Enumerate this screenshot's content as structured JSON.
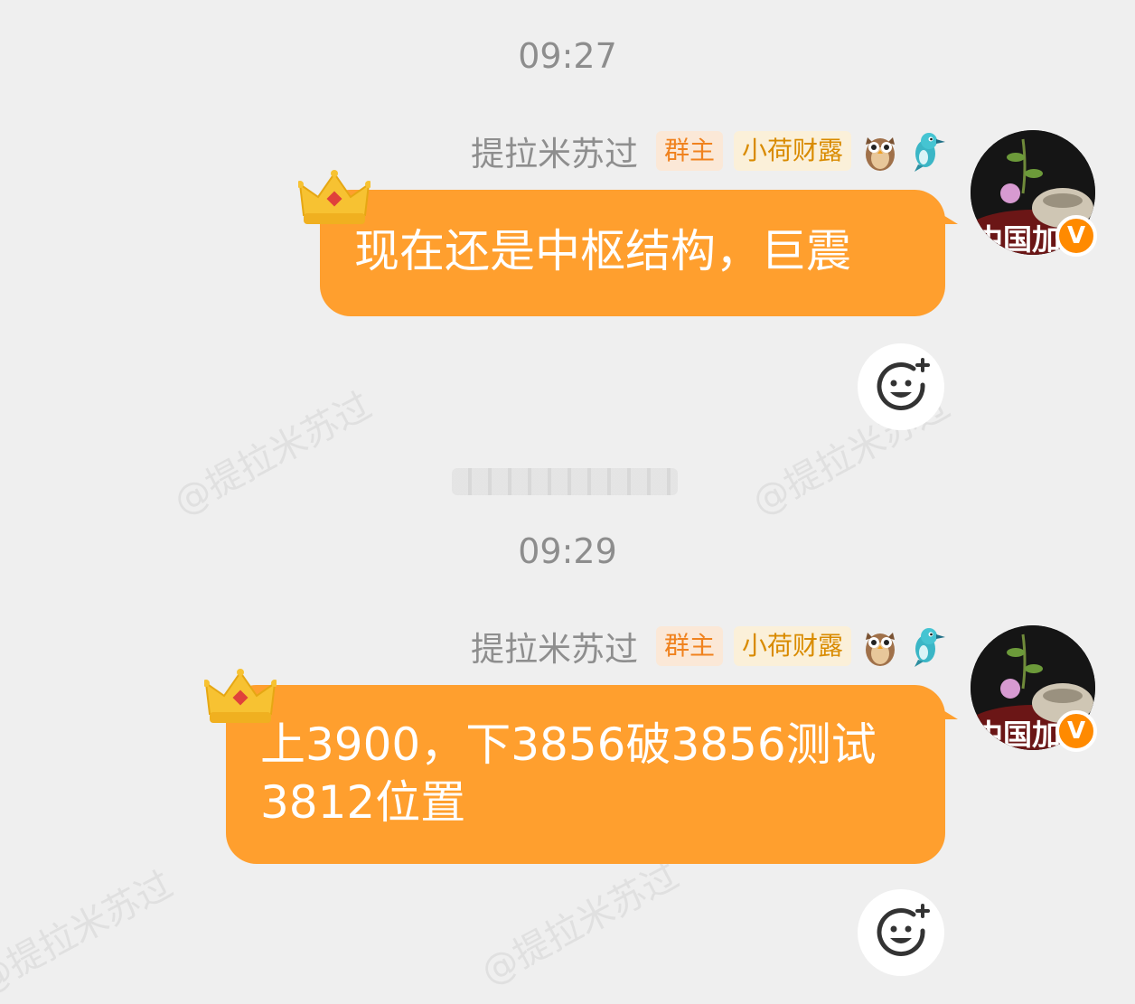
{
  "watermark": "@提拉米苏过",
  "messages": [
    {
      "time": "09:27",
      "sender": "提拉米苏过",
      "badge_owner": "群主",
      "badge_fan": "小荷财露",
      "text_lines": [
        "现在还是中枢结构，巨震"
      ],
      "avatar_label": "中国加",
      "verified_mark": "V"
    },
    {
      "time": "09:29",
      "sender": "提拉米苏过",
      "badge_owner": "群主",
      "badge_fan": "小荷财露",
      "text_lines": [
        "上3900，下3856破3856测试",
        "3812位置"
      ],
      "avatar_label": "中国加",
      "verified_mark": "V"
    }
  ],
  "icons": {
    "emoji_1": "owl-icon",
    "emoji_2": "bird-icon",
    "crown": "crown-icon",
    "reaction": "add-reaction-icon"
  },
  "colors": {
    "bubble": "#ff9f2e",
    "background": "#efefef",
    "badge_owner_text": "#f0821e"
  }
}
